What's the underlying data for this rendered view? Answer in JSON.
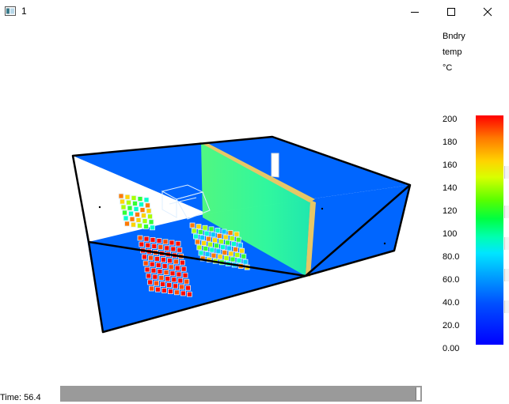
{
  "window": {
    "title": "1"
  },
  "legend": {
    "title_lines": [
      "Bndry",
      "temp",
      "°C"
    ],
    "ticks": [
      "200",
      "180",
      "160",
      "140",
      "120",
      "100",
      "80.0",
      "60.0",
      "40.0",
      "20.0",
      "0.00"
    ],
    "scale_min": 0,
    "scale_max": 200,
    "colors": {
      "high": "#ff0000",
      "mid": "#00ff40",
      "low": "#0000ff"
    }
  },
  "time": {
    "label": "Time: 56.4"
  },
  "scene": {
    "wall_color": "#0066ff",
    "partition_color": "#33ff99",
    "post_color": "#e6c766"
  }
}
